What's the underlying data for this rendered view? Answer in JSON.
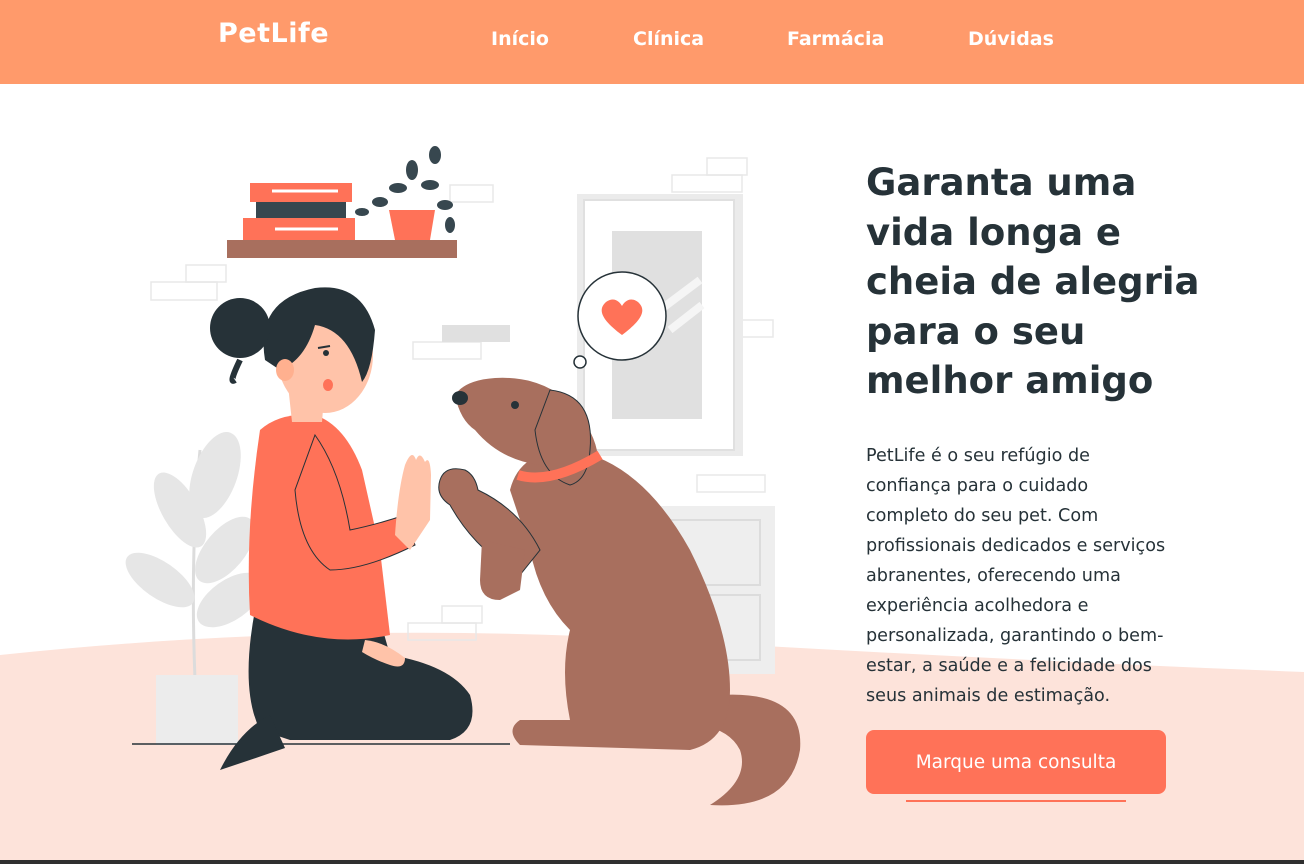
{
  "header": {
    "logo": "PetLife",
    "nav": [
      "Início",
      "Clínica",
      "Farmácia",
      "Dúvidas"
    ]
  },
  "hero": {
    "title_lines": [
      "Garanta uma",
      "vida longa e",
      "cheia de alegria",
      "para o seu",
      "melhor amigo"
    ],
    "description_lines": [
      "PetLife é o seu refúgio de",
      "confiança para o cuidado",
      "completo do seu pet. Com",
      "profissionais dedicados e serviços",
      "abranentes, oferecendo uma",
      "experiência acolhedora e",
      "personalizada, garantindo o bem-",
      "estar, a saúde e a felicidade dos",
      "seus animais de estimação."
    ],
    "cta_label": "Marque uma consulta"
  },
  "colors": {
    "header_bg": "#ff9a6b",
    "accent": "#ff7258",
    "floor": "#fde3da",
    "text_dark": "#263238",
    "dog": "#a86f5e"
  },
  "icons": {
    "heart": "heart-icon"
  }
}
